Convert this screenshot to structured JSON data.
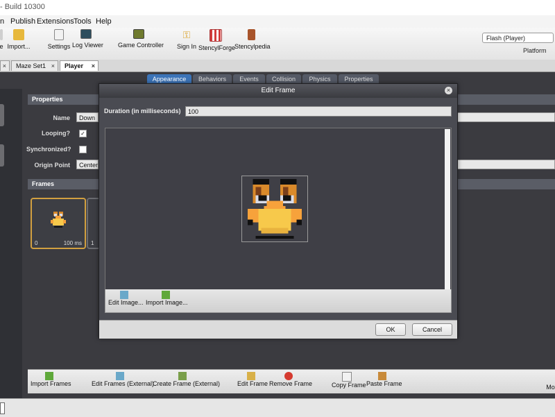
{
  "window": {
    "title": "- Build 10300"
  },
  "menu": [
    "n",
    "Publish",
    "Extensions",
    "Tools",
    "Help"
  ],
  "toolbar": {
    "buttons": [
      {
        "label": "e",
        "icon": "partial-icon"
      },
      {
        "label": "Import...",
        "icon": "import-icon"
      },
      {
        "label": "Settings",
        "icon": "settings-icon"
      },
      {
        "label": "Log Viewer",
        "icon": "log-viewer-icon"
      },
      {
        "label": "Game Controller",
        "icon": "game-controller-icon"
      },
      {
        "label": "Sign In",
        "icon": "key-icon"
      },
      {
        "label": "StencylForge",
        "icon": "store-icon"
      },
      {
        "label": "Stencylpedia",
        "icon": "book-icon"
      }
    ],
    "platform_value": "Flash (Player)",
    "platform_label": "Platform"
  },
  "tabs": {
    "documents": [
      {
        "label": "Maze Set1",
        "active": false
      },
      {
        "label": "Player",
        "active": true
      }
    ],
    "sub": [
      "Appearance",
      "Behaviors",
      "Events",
      "Collision",
      "Physics",
      "Properties"
    ]
  },
  "properties": {
    "header": "Properties",
    "name_label": "Name",
    "name_value": "Down",
    "looping_label": "Looping?",
    "looping_checked": "✓",
    "synchronized_label": "Synchronized?",
    "origin_label": "Origin Point",
    "origin_value": "Center"
  },
  "frames": {
    "header": "Frames",
    "items": [
      {
        "index": "0",
        "duration": "100 ms"
      },
      {
        "index": "1",
        "duration": ""
      }
    ]
  },
  "bottom_toolbar": [
    "Import Frames",
    "Edit Frames (External)",
    "Create Frame (External)",
    "Edit Frame",
    "Remove Frame",
    "Copy Frame",
    "Paste Frame",
    "Mo"
  ],
  "dialog": {
    "title": "Edit Frame",
    "duration_label": "Duration (in milliseconds)",
    "duration_value": "100",
    "tools": [
      "Edit Image...",
      "Import Image..."
    ],
    "ok": "OK",
    "cancel": "Cancel"
  },
  "colors": {
    "accent": "#3c74b8",
    "frame_selected": "#d2a040",
    "duck_body": "#f7c94b",
    "duck_shadow": "#d98a2b",
    "eye_ring": "#d9dce8"
  }
}
